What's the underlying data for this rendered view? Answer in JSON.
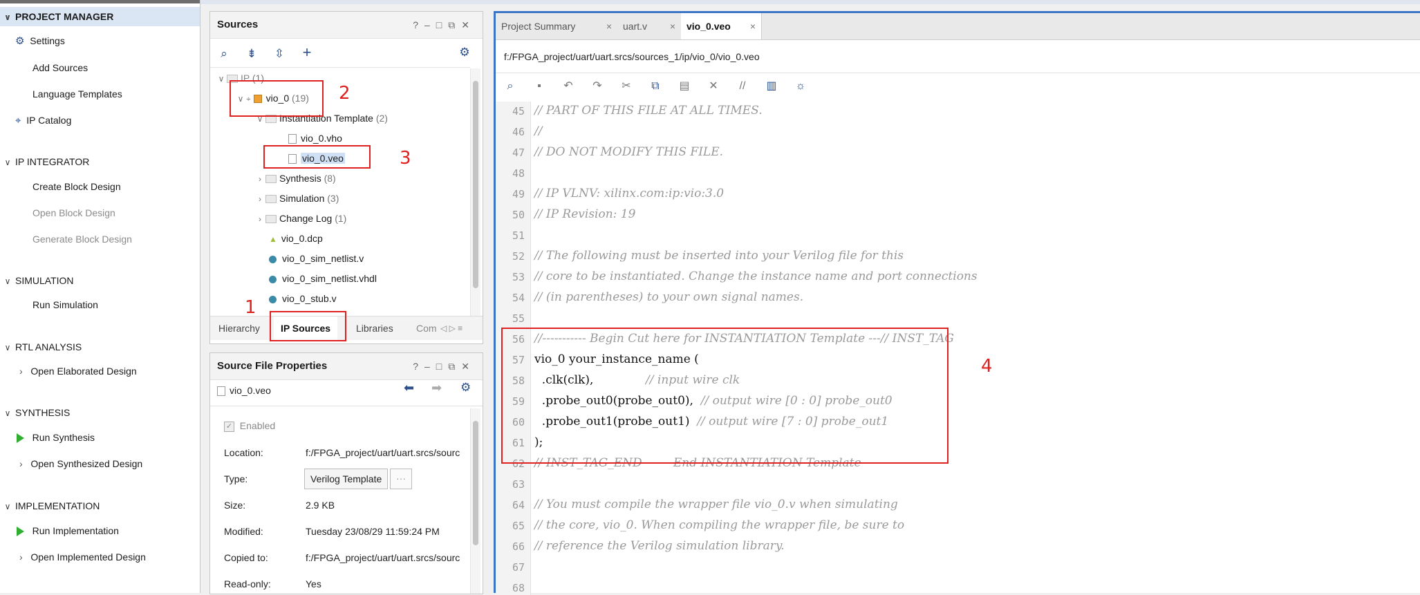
{
  "flow_nav": {
    "project_manager": {
      "title": "PROJECT MANAGER",
      "items": [
        "Settings",
        "Add Sources",
        "Language Templates",
        "IP Catalog"
      ]
    },
    "ip_integrator": {
      "title": "IP INTEGRATOR",
      "items": [
        "Create Block Design",
        "Open Block Design",
        "Generate Block Design"
      ]
    },
    "simulation": {
      "title": "SIMULATION",
      "items": [
        "Run Simulation"
      ]
    },
    "rtl_analysis": {
      "title": "RTL ANALYSIS",
      "items": [
        "Open Elaborated Design"
      ]
    },
    "synthesis": {
      "title": "SYNTHESIS",
      "items": [
        "Run Synthesis",
        "Open Synthesized Design"
      ]
    },
    "implementation": {
      "title": "IMPLEMENTATION",
      "items": [
        "Run Implementation",
        "Open Implemented Design"
      ]
    }
  },
  "sources": {
    "title": "Sources",
    "tree": [
      {
        "label": "IP",
        "count": "(1)"
      },
      {
        "label": "vio_0",
        "count": "(19)"
      },
      {
        "label": "Instantiation Template",
        "count": "(2)"
      },
      {
        "label": "vio_0.vho",
        "count": ""
      },
      {
        "label": "vio_0.veo",
        "count": ""
      },
      {
        "label": "Synthesis",
        "count": "(8)"
      },
      {
        "label": "Simulation",
        "count": "(3)"
      },
      {
        "label": "Change Log",
        "count": "(1)"
      },
      {
        "label": "vio_0.dcp",
        "count": ""
      },
      {
        "label": "vio_0_sim_netlist.v",
        "count": ""
      },
      {
        "label": "vio_0_sim_netlist.vhdl",
        "count": ""
      },
      {
        "label": "vio_0_stub.v",
        "count": ""
      }
    ],
    "tabs": [
      "Hierarchy",
      "IP Sources",
      "Libraries",
      "Com"
    ]
  },
  "properties": {
    "title": "Source File Properties",
    "file": "vio_0.veo",
    "enabled": "Enabled",
    "rows": [
      {
        "label": "Location:",
        "value": "f:/FPGA_project/uart/uart.srcs/sourc"
      },
      {
        "label": "Type:",
        "value": "Verilog Template"
      },
      {
        "label": "Size:",
        "value": "2.9 KB"
      },
      {
        "label": "Modified:",
        "value": "Tuesday 23/08/29 11:59:24 PM"
      },
      {
        "label": "Copied to:",
        "value": "f:/FPGA_project/uart/uart.srcs/sourc"
      },
      {
        "label": "Read-only:",
        "value": "Yes"
      }
    ],
    "type_more": "···"
  },
  "editor": {
    "tabs": [
      "Project Summary",
      "uart.v",
      "vio_0.veo"
    ],
    "path": "f:/FPGA_project/uart/uart.srcs/sources_1/ip/vio_0/vio_0.veo",
    "lines": [
      {
        "n": "45",
        "text": "// PART OF THIS FILE AT ALL TIMES.",
        "c": true
      },
      {
        "n": "46",
        "text": "//",
        "c": true
      },
      {
        "n": "47",
        "text": "// DO NOT MODIFY THIS FILE.",
        "c": true
      },
      {
        "n": "48",
        "text": "",
        "c": false
      },
      {
        "n": "49",
        "text": "// IP VLNV: xilinx.com:ip:vio:3.0",
        "c": true
      },
      {
        "n": "50",
        "text": "// IP Revision: 19",
        "c": true
      },
      {
        "n": "51",
        "text": "",
        "c": false
      },
      {
        "n": "52",
        "text": "// The following must be inserted into your Verilog file for this",
        "c": true
      },
      {
        "n": "53",
        "text": "// core to be instantiated. Change the instance name and port connections",
        "c": true
      },
      {
        "n": "54",
        "text": "// (in parentheses) to your own signal names.",
        "c": true
      },
      {
        "n": "55",
        "text": "",
        "c": false
      },
      {
        "n": "56",
        "text": "//----------- Begin Cut here for INSTANTIATION Template ---// INST_TAG",
        "c": true
      },
      {
        "n": "57",
        "text": "vio_0 your_instance_name (",
        "c": false
      },
      {
        "n": "58",
        "text": "  .clk(clk),",
        "c": false,
        "tail": "              // input wire clk"
      },
      {
        "n": "59",
        "text": "  .probe_out0(probe_out0),",
        "c": false,
        "tail": "  // output wire [0 : 0] probe_out0"
      },
      {
        "n": "60",
        "text": "  .probe_out1(probe_out1)",
        "c": false,
        "tail": "  // output wire [7 : 0] probe_out1"
      },
      {
        "n": "61",
        "text": ");",
        "c": false
      },
      {
        "n": "62",
        "text": "// INST_TAG_END ------ End INSTANTIATION Template ---------",
        "c": true
      },
      {
        "n": "63",
        "text": "",
        "c": false
      },
      {
        "n": "64",
        "text": "// You must compile the wrapper file vio_0.v when simulating",
        "c": true
      },
      {
        "n": "65",
        "text": "// the core, vio_0. When compiling the wrapper file, be sure to",
        "c": true
      },
      {
        "n": "66",
        "text": "// reference the Verilog simulation library.",
        "c": true
      },
      {
        "n": "67",
        "text": "",
        "c": false
      },
      {
        "n": "68",
        "text": "",
        "c": false
      }
    ]
  },
  "annotations": [
    "1",
    "2",
    "3",
    "4"
  ],
  "colors": {
    "annotation": "#e01f1f",
    "editor_border": "#3b75c8",
    "comment": "#9a9a9a"
  }
}
